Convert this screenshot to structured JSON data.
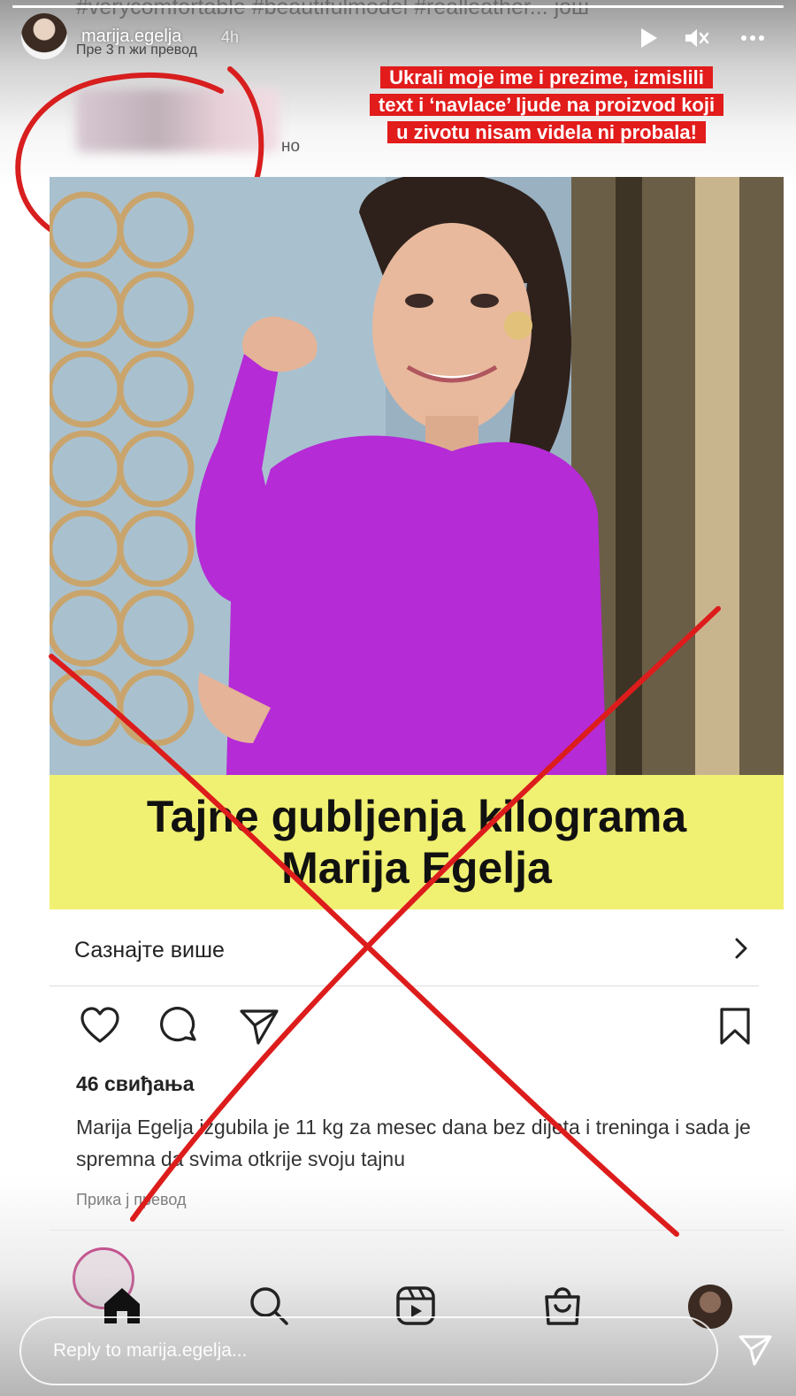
{
  "story": {
    "hashtags": "#verycomfortable #beautifulmodel #realleather... још",
    "username": "marija.egelja",
    "time": "4h",
    "translation_line": "Пре 3 п          жи превод",
    "progress": 1.0
  },
  "annotation": {
    "lines": [
      "Ukrali moje ime i prezime, izmislili",
      "text i ‘navlace’ ljude na proizvod koji",
      "u zivotu nisam videla ni probala!"
    ],
    "name_suffix": "но"
  },
  "post": {
    "headline_line1": "Tajne gubljenja kilograma",
    "headline_line2": "Marija Egelja",
    "learn_more": "Сазнајте више",
    "likes": "46 свиђања",
    "caption": "Marija Egelja izgubila je 11 kg za mesec dana bez dijeta i treninga i sada je spremna da svima otkrije svoju tajnu",
    "show_translation": "Прика   ј превод"
  },
  "reply": {
    "placeholder": "Reply to marija.egelja..."
  },
  "icons": {
    "play": "play-icon",
    "mute": "mute-icon",
    "more": "more-icon",
    "like": "heart-icon",
    "comment": "comment-icon",
    "share": "send-icon",
    "save": "bookmark-icon",
    "home": "home-icon",
    "search": "search-icon",
    "reels": "reels-icon",
    "shop": "shop-icon",
    "reply_send": "send-icon"
  },
  "colors": {
    "annotation_red": "#e21b1b",
    "headline_yellow": "#f0f072",
    "dress_purple": "#b52bd6"
  }
}
